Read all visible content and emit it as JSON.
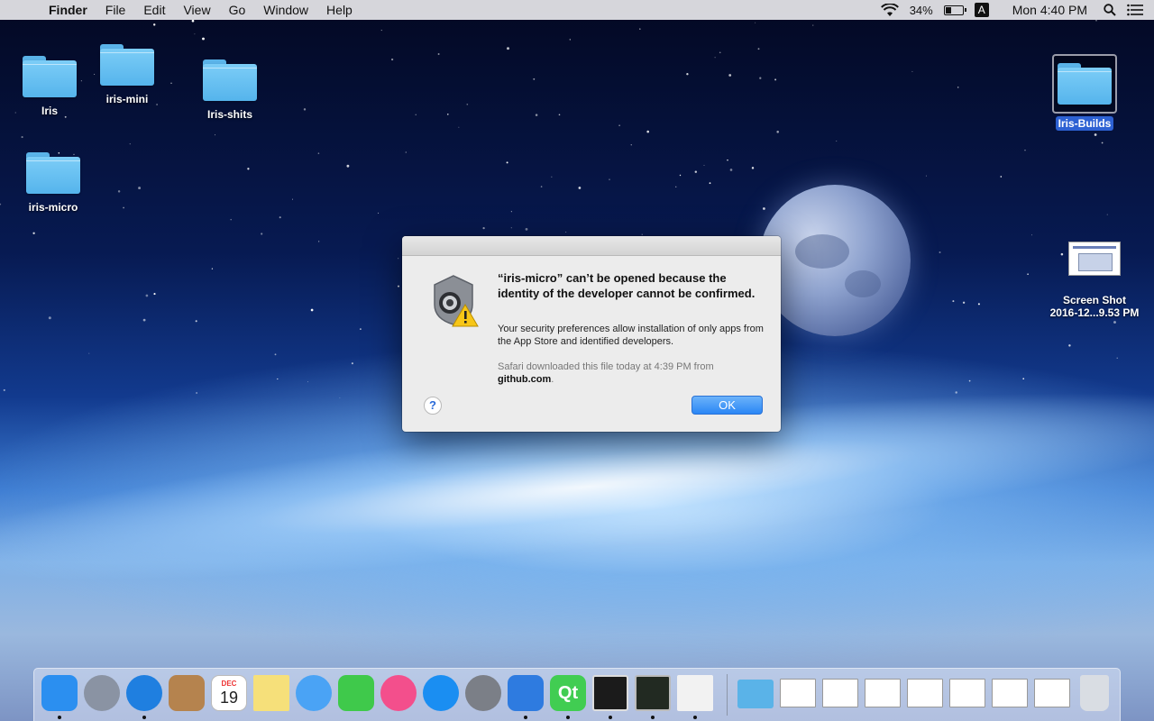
{
  "menubar": {
    "app_name": "Finder",
    "items": [
      "File",
      "Edit",
      "View",
      "Go",
      "Window",
      "Help"
    ],
    "battery_percent": "34%",
    "battery_level": 0.34,
    "input_source": "A",
    "clock": "Mon 4:40 PM"
  },
  "desktop": {
    "icons": [
      {
        "label": "Iris"
      },
      {
        "label": "iris-mini"
      },
      {
        "label": "Iris-shits"
      },
      {
        "label": "iris-micro"
      },
      {
        "label": "Iris-Builds"
      },
      {
        "label_line1": "Screen Shot",
        "label_line2": "2016-12...9.53 PM"
      }
    ]
  },
  "dialog": {
    "title": "“iris-micro” can’t be opened because the identity of the developer cannot be confirmed.",
    "body": "Your security preferences allow installation of only apps from the App Store and identified developers.",
    "source_prefix": "Safari downloaded this file today at 4:39 PM from",
    "source_domain": "github.com",
    "help_label": "?",
    "ok_label": "OK"
  },
  "dock": {
    "apps": [
      {
        "icon": "finder-icon",
        "color": "#2b8ff0",
        "running": true
      },
      {
        "icon": "launchpad-icon",
        "color": "#8a93a3",
        "running": false
      },
      {
        "icon": "safari-icon",
        "color": "#1f7fe0",
        "running": true
      },
      {
        "icon": "contacts-icon",
        "color": "#b5834e",
        "running": false
      },
      {
        "icon": "calendar-icon",
        "color": "#ffffff",
        "running": false,
        "month": "DEC",
        "day": "19"
      },
      {
        "icon": "notes-icon",
        "color": "#f6e07a",
        "running": false
      },
      {
        "icon": "messages-icon",
        "color": "#4aa3f5",
        "running": false
      },
      {
        "icon": "facetime-icon",
        "color": "#3fc94b",
        "running": false
      },
      {
        "icon": "itunes-icon",
        "color": "#f34f8c",
        "running": false
      },
      {
        "icon": "app-store-icon",
        "color": "#1a8ef2",
        "running": false
      },
      {
        "icon": "system-preferences-icon",
        "color": "#7b7f87",
        "running": false
      },
      {
        "icon": "xcode-icon",
        "color": "#2e7be0",
        "running": true
      },
      {
        "icon": "qt-creator-icon",
        "color": "#41cd52",
        "running": true,
        "text": "Qt"
      },
      {
        "icon": "terminal-icon",
        "color": "#1b1b1b",
        "running": true
      },
      {
        "icon": "activity-monitor-icon",
        "color": "#222a22",
        "running": true
      },
      {
        "icon": "textedit-icon",
        "color": "#f2f2f2",
        "running": true
      }
    ],
    "docs": [
      {
        "icon": "downloads-folder-icon",
        "color": "#5ab3e8"
      },
      {
        "icon": "document-thumbnail-icon",
        "color": "#ffffff"
      },
      {
        "icon": "document-thumbnail-icon",
        "color": "#ffffff"
      },
      {
        "icon": "document-thumbnail-icon",
        "color": "#ffffff"
      },
      {
        "icon": "document-thumbnail-icon",
        "color": "#ffffff"
      },
      {
        "icon": "document-thumbnail-icon",
        "color": "#ffffff"
      },
      {
        "icon": "document-thumbnail-icon",
        "color": "#ffffff"
      },
      {
        "icon": "document-thumbnail-icon",
        "color": "#ffffff"
      },
      {
        "icon": "trash-icon",
        "color": "#d9dde3"
      }
    ]
  }
}
